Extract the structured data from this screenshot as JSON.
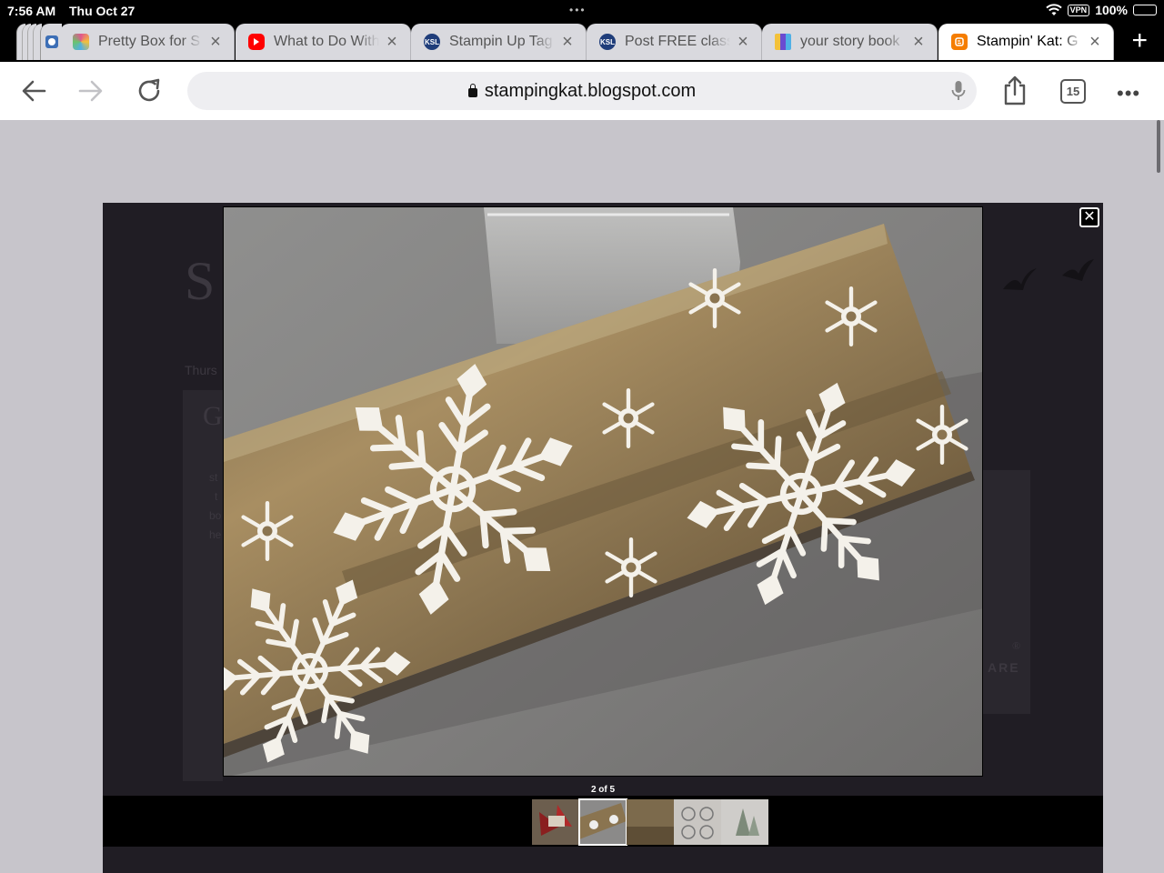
{
  "status_bar": {
    "time": "7:56 AM",
    "date": "Thu Oct 27",
    "vpn_label": "VPN",
    "battery_text": "100%",
    "battery_level": 1.0
  },
  "tabs": [
    {
      "title": "Pretty Box for S",
      "favicon": "pretty-box-favicon",
      "color": "#e2558e"
    },
    {
      "title": "What to Do With",
      "favicon": "youtube-favicon",
      "color": "#ff0000"
    },
    {
      "title": "Stampin Up Tag",
      "favicon": "ksl-favicon",
      "color": "#1f3d7a"
    },
    {
      "title": "Post FREE class",
      "favicon": "ksl-favicon",
      "color": "#1f3d7a"
    },
    {
      "title": "your story book",
      "favicon": "shopping-bag-favicon",
      "color": "#6a4bd1"
    },
    {
      "title": "Stampin' Kat: G",
      "favicon": "blogger-favicon",
      "color": "#f57d00",
      "active": true
    }
  ],
  "favicon_text": {
    "ksl": "KSL"
  },
  "toolbar": {
    "url": "stampingkat.blogspot.com",
    "tab_count": "15"
  },
  "background_page": {
    "title_glyph": "S",
    "date_fragment": "Thurs",
    "post_title_glyph": "G",
    "text_lines": [
      "st",
      "t",
      "bo",
      "he"
    ],
    "badge_text": "ARE",
    "registered": "®"
  },
  "lightbox": {
    "counter": "2 of 5",
    "total_images": 5,
    "current_index": 2,
    "close_symbol": "✕"
  },
  "colors": {
    "accent_active_tab": "#ffffff",
    "lightbox_bg": "#201d24",
    "page_bg": "#c7c5cb",
    "lavender": "#b59ad6"
  }
}
